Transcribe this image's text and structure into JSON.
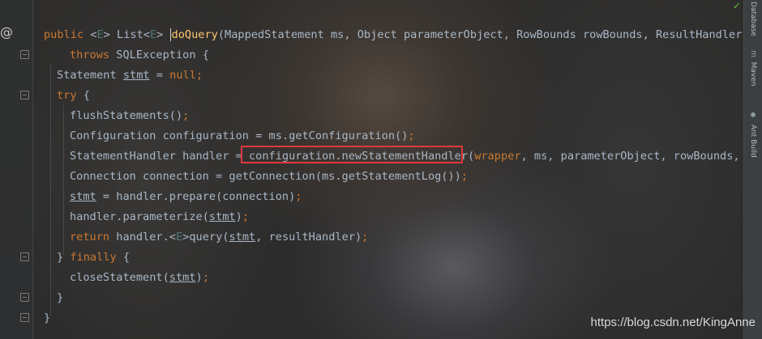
{
  "editor": {
    "lines": [
      {
        "indent": 0,
        "tokens": [
          {
            "t": "public ",
            "c": "kw"
          },
          {
            "t": "<",
            "c": "plain"
          },
          {
            "t": "E",
            "c": "gen"
          },
          {
            "t": "> List",
            "c": "plain"
          },
          {
            "t": "<",
            "c": "plain"
          },
          {
            "t": "E",
            "c": "gen"
          },
          {
            "t": "> ",
            "c": "plain"
          },
          {
            "t": "",
            "c": "caret"
          },
          {
            "t": "doQuery",
            "c": "mth"
          },
          {
            "t": "(MappedStatement ms, Object parameterObject, RowBounds rowBounds, ResultHandler resu",
            "c": "plain"
          }
        ]
      },
      {
        "indent": 2,
        "tokens": [
          {
            "t": "throws ",
            "c": "kw"
          },
          {
            "t": "SQLException {",
            "c": "plain"
          }
        ]
      },
      {
        "indent": 1,
        "tokens": [
          {
            "t": "Statement ",
            "c": "plain"
          },
          {
            "t": "stmt",
            "c": "ul"
          },
          {
            "t": " = ",
            "c": "plain"
          },
          {
            "t": "null",
            "c": "kw"
          },
          {
            "t": ";",
            "c": "kw"
          }
        ]
      },
      {
        "indent": 1,
        "tokens": [
          {
            "t": "try ",
            "c": "kw"
          },
          {
            "t": "{",
            "c": "plain"
          }
        ]
      },
      {
        "indent": 2,
        "tokens": [
          {
            "t": "flushStatements()",
            "c": "plain"
          },
          {
            "t": ";",
            "c": "kw"
          }
        ]
      },
      {
        "indent": 2,
        "tokens": [
          {
            "t": "Configuration configuration = ms.getConfiguration()",
            "c": "plain"
          },
          {
            "t": ";",
            "c": "kw"
          }
        ]
      },
      {
        "indent": 2,
        "tokens": [
          {
            "t": "StatementHandler handler = configuration.newStatementHandler(",
            "c": "plain"
          },
          {
            "t": "wrapper",
            "c": "kw"
          },
          {
            "t": ", ms, parameterObject, rowBounds, resu",
            "c": "plain"
          }
        ]
      },
      {
        "indent": 2,
        "tokens": [
          {
            "t": "Connection connection = getConnection(ms.getStatementLog())",
            "c": "plain"
          },
          {
            "t": ";",
            "c": "kw"
          }
        ]
      },
      {
        "indent": 2,
        "tokens": [
          {
            "t": "stmt",
            "c": "ul"
          },
          {
            "t": " = handler.prepare(connection)",
            "c": "plain"
          },
          {
            "t": ";",
            "c": "kw"
          }
        ]
      },
      {
        "indent": 2,
        "tokens": [
          {
            "t": "handler.parameterize(",
            "c": "plain"
          },
          {
            "t": "stmt",
            "c": "ul"
          },
          {
            "t": ")",
            "c": "plain"
          },
          {
            "t": ";",
            "c": "kw"
          }
        ]
      },
      {
        "indent": 2,
        "tokens": [
          {
            "t": "return ",
            "c": "kw"
          },
          {
            "t": "handler.<",
            "c": "plain"
          },
          {
            "t": "E",
            "c": "gen"
          },
          {
            "t": ">query(",
            "c": "plain"
          },
          {
            "t": "stmt",
            "c": "ul"
          },
          {
            "t": ", resultHandler)",
            "c": "plain"
          },
          {
            "t": ";",
            "c": "kw"
          }
        ]
      },
      {
        "indent": 1,
        "tokens": [
          {
            "t": "} ",
            "c": "plain"
          },
          {
            "t": "finally ",
            "c": "kw"
          },
          {
            "t": "{",
            "c": "plain"
          }
        ]
      },
      {
        "indent": 2,
        "tokens": [
          {
            "t": "closeStatement(",
            "c": "plain"
          },
          {
            "t": "stmt",
            "c": "ul"
          },
          {
            "t": ")",
            "c": "plain"
          },
          {
            "t": ";",
            "c": "kw"
          }
        ]
      },
      {
        "indent": 1,
        "tokens": [
          {
            "t": "}",
            "c": "plain"
          }
        ]
      },
      {
        "indent": 0,
        "tokens": [
          {
            "t": "}",
            "c": "plain"
          }
        ]
      }
    ]
  },
  "gutter": {
    "annotation_glyph": "@"
  },
  "right_toolbar": {
    "tabs": [
      {
        "label": "Database",
        "icon": "database-icon"
      },
      {
        "label": "Maven",
        "icon": "maven-icon"
      },
      {
        "label": "Ant Build",
        "icon": "ant-icon"
      }
    ],
    "status_check": "✓"
  },
  "watermark": "https://blog.csdn.net/KingAnne",
  "colors": {
    "keyword": "#cc7832",
    "generic": "#507874",
    "method": "#ffc66d",
    "text": "#a9b7c6",
    "highlight_box": "#e0383e"
  }
}
